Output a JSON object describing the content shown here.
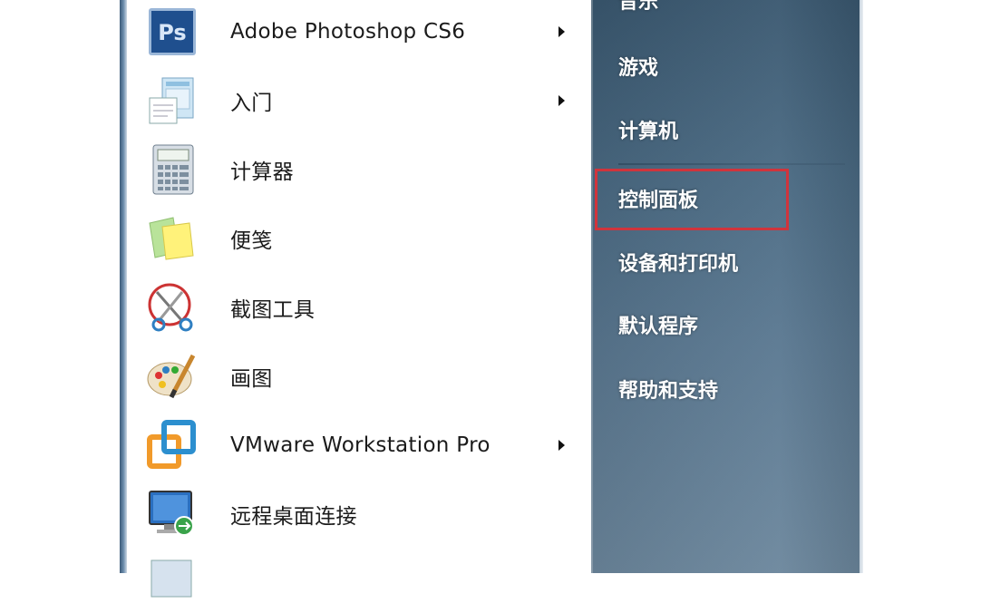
{
  "programs": {
    "items": [
      {
        "label": "Adobe Photoshop CS6",
        "icon": "photoshop-icon",
        "submenu": true
      },
      {
        "label": "入门",
        "icon": "getting-started-icon",
        "submenu": true
      },
      {
        "label": "计算器",
        "icon": "calculator-icon",
        "submenu": false
      },
      {
        "label": "便笺",
        "icon": "sticky-notes-icon",
        "submenu": false
      },
      {
        "label": "截图工具",
        "icon": "snipping-tool-icon",
        "submenu": false
      },
      {
        "label": "画图",
        "icon": "paint-icon",
        "submenu": false
      },
      {
        "label": "VMware Workstation Pro",
        "icon": "vmware-icon",
        "submenu": true
      },
      {
        "label": "远程桌面连接",
        "icon": "remote-desktop-icon",
        "submenu": false
      }
    ],
    "ps_icon_text": "Ps"
  },
  "places": {
    "items": [
      {
        "label": "音乐"
      },
      {
        "label": "游戏"
      },
      {
        "label": "计算机"
      },
      {
        "label": "控制面板"
      },
      {
        "label": "设备和打印机"
      },
      {
        "label": "默认程序"
      },
      {
        "label": "帮助和支持"
      }
    ]
  },
  "colors": {
    "highlight_border": "#d0343c",
    "places_bg": "#4a6a83",
    "ps_blue": "#1f4f8e"
  }
}
